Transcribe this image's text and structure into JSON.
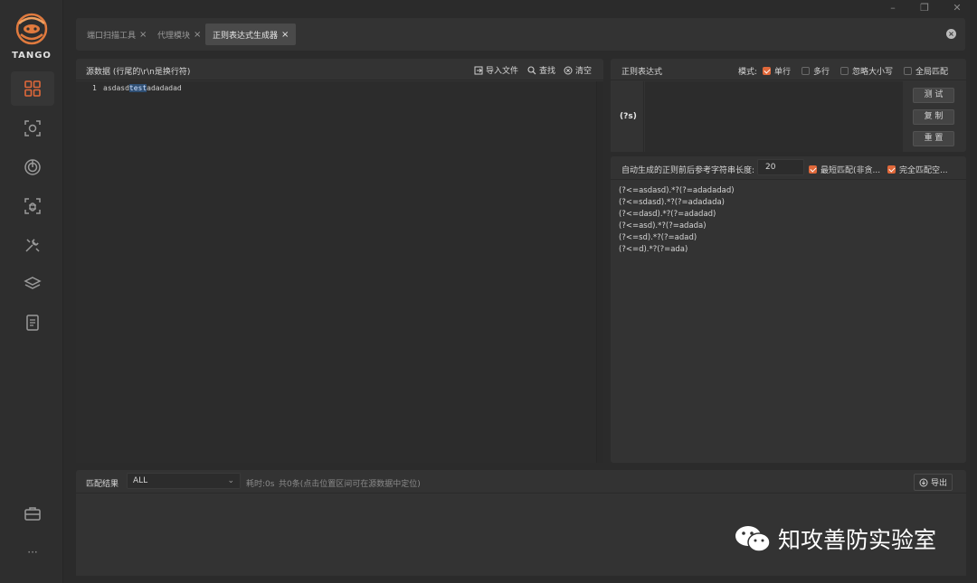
{
  "brand": {
    "logo_text": "TANGO"
  },
  "window": {
    "minimize": "–",
    "restore": "❐",
    "close": "✕"
  },
  "tabs": [
    {
      "label": "端口扫描工具",
      "close": "×"
    },
    {
      "label": "代理模块",
      "close": "×"
    },
    {
      "label": "正则表达式生成器",
      "close": "×"
    }
  ],
  "source": {
    "title": "源数据 (行尾的\\r\\n是换行符)",
    "import_label": "导入文件",
    "find_label": "查找",
    "clear_label": "清空",
    "line_number": "1",
    "text_before": "asdasd",
    "text_highlight": "test",
    "text_after": "adadadad"
  },
  "regex": {
    "title": "正则表达式",
    "mode_label": "模式:",
    "options": [
      {
        "label": "单行",
        "checked": true
      },
      {
        "label": "多行",
        "checked": false
      },
      {
        "label": "忽略大小写",
        "checked": false
      },
      {
        "label": "全局匹配",
        "checked": false
      }
    ],
    "prefix": "(?s)",
    "test_label": "测 试",
    "copy_label": "复 制",
    "reset_label": "重 置"
  },
  "generator": {
    "length_label": "自动生成的正则前后参考字符串长度:",
    "length_value": "20",
    "opt_shortest": "最短匹配(非贪...",
    "opt_full": "完全匹配空...",
    "results": [
      "(?<=asdasd).*?(?=adadadad)",
      "(?<=sdasd).*?(?=adadada)",
      "(?<=dasd).*?(?=adadad)",
      "(?<=asd).*?(?=adada)",
      "(?<=sd).*?(?=adad)",
      "(?<=d).*?(?=ada)"
    ]
  },
  "match": {
    "title": "匹配结果",
    "select_value": "ALL",
    "time_text": "耗时:0s",
    "count_text": "共0条(点击位置区间可在源数据中定位)",
    "export_label": "导出"
  },
  "sidebar": {
    "more": "···"
  },
  "watermark": {
    "text": "知攻善防实验室"
  },
  "colors": {
    "accent": "#e0683a",
    "highlight": "#2f4f73"
  }
}
